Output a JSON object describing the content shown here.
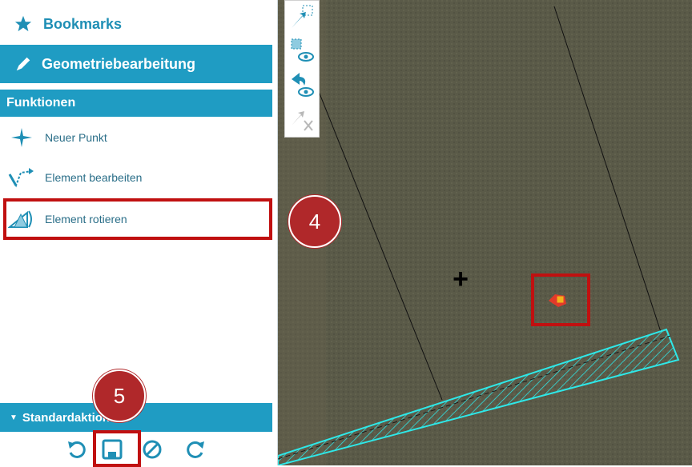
{
  "sidebar": {
    "bookmarks_label": "Bookmarks",
    "geometry_label": "Geometriebearbeitung",
    "functions_header": "Funktionen",
    "tools": [
      {
        "label": "Neuer Punkt",
        "icon": "crosshair-point-icon"
      },
      {
        "label": "Element bearbeiten",
        "icon": "edit-vertices-icon"
      },
      {
        "label": "Element rotieren",
        "icon": "rotate-element-icon"
      }
    ],
    "standard_header": "Standardaktionen",
    "standard_tools": [
      "undo-icon",
      "save-icon",
      "cancel-icon",
      "redo-icon"
    ]
  },
  "annotations": {
    "step4": "4",
    "step5": "5"
  },
  "map": {
    "toolbar_icons": [
      "select-arrow-icon",
      "eye-toggle-icon",
      "back-arrow-icon",
      "eye-icon",
      "disabled-arrow-icon"
    ],
    "cursor_symbol": "+"
  },
  "colors": {
    "accent": "#1f9cc3",
    "highlight": "#c01010",
    "badge": "#b0282a",
    "hatch": "#2ee8e8"
  }
}
